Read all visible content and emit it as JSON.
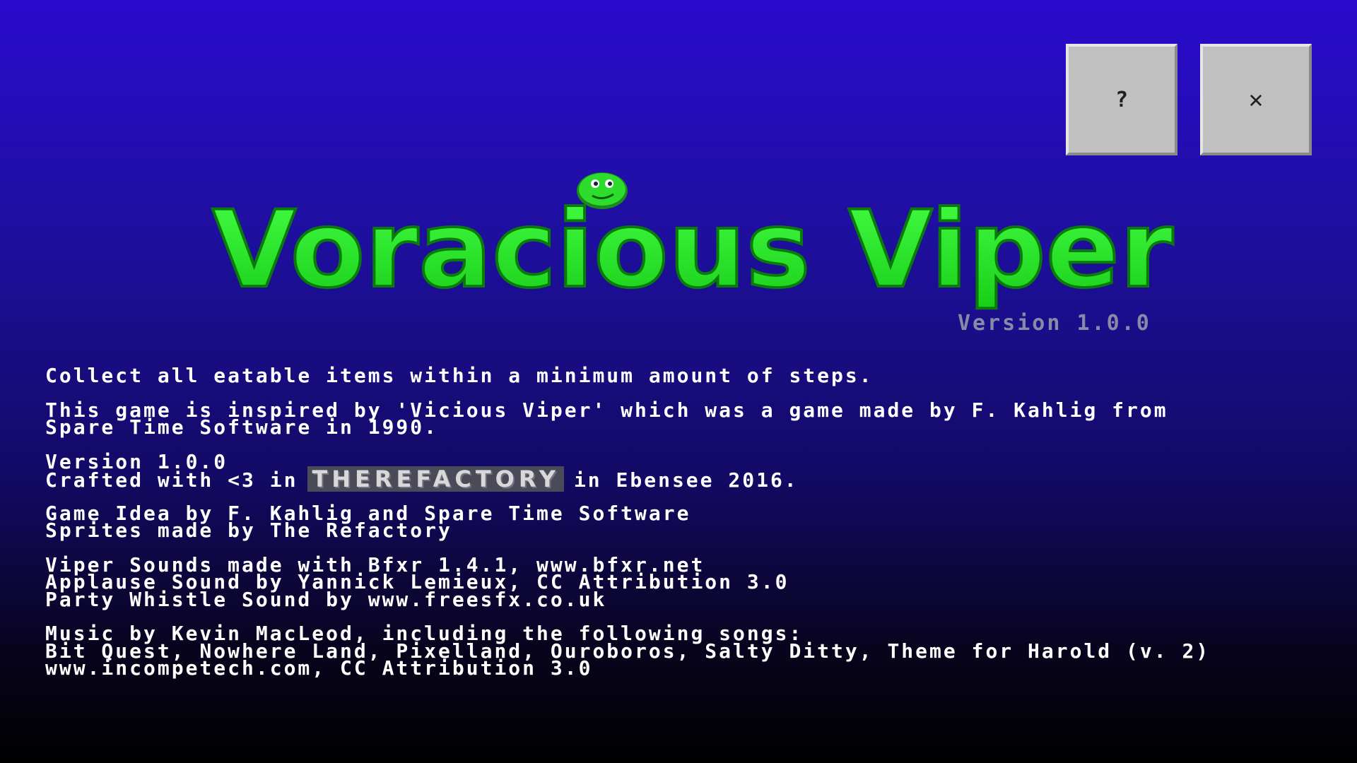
{
  "buttons": {
    "help_label": "?",
    "close_label": "✕"
  },
  "logo": {
    "title": "Voracious Viper",
    "version": "Version 1.0.0"
  },
  "credits": {
    "objective": "Collect all eatable items within a minimum amount of steps.",
    "inspiration_line1": "This game is inspired by 'Vicious Viper' which was a game made by F. Kahlig from",
    "inspiration_line2": "Spare Time Software in 1990.",
    "version": "Version 1.0.0",
    "crafted_prefix": "Crafted with <3 in",
    "crafted_logo": "THEREFACTORY",
    "crafted_suffix": "in Ebensee 2016.",
    "idea_line": "Game Idea by F. Kahlig and Spare Time Software",
    "sprites_line": "Sprites made by The Refactory",
    "sounds_line1": "Viper Sounds made with Bfxr 1.4.1, www.bfxr.net",
    "sounds_line2": "Applause Sound by Yannick Lemieux, CC Attribution 3.0",
    "sounds_line3": "Party Whistle Sound by www.freesfx.co.uk",
    "music_line1": "Music by Kevin MacLeod, including the following songs:",
    "music_line2": "Bit Quest, Nowhere Land, Pixelland, Ouroboros, Salty Ditty, Theme for Harold (v. 2)",
    "music_line3": "www.incompetech.com, CC Attribution 3.0"
  },
  "colors": {
    "logo_green": "#22ee22",
    "logo_dark_green": "#0a7a0a",
    "button_gray": "#c0c0c0",
    "text_white": "#ffffff",
    "version_gray": "#8a8aa8"
  }
}
